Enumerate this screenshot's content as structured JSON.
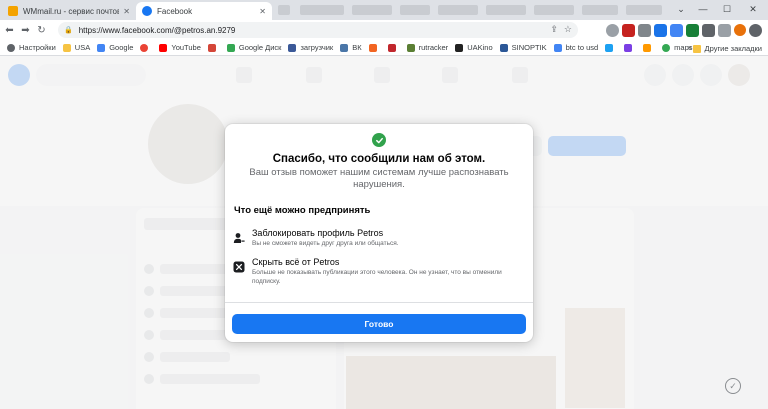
{
  "browser": {
    "tabs": [
      {
        "title": "WMmail.ru - сервис почтовых ра",
        "icon": "wmmail-favicon",
        "active": false
      },
      {
        "title": "Facebook",
        "icon": "facebook-favicon",
        "active": true
      }
    ],
    "url": "https://www.facebook.com/@petros.an.9279",
    "bookmarks": [
      {
        "label": "Настройки",
        "color": "#5f6368"
      },
      {
        "label": "USA",
        "color": "#f6c343"
      },
      {
        "label": "Google",
        "color": "#4285f4"
      },
      {
        "label": "",
        "color": "#ea4335"
      },
      {
        "label": "YouTube",
        "color": "#ff0000"
      },
      {
        "label": "",
        "color": "#d44638"
      },
      {
        "label": "Google Диск",
        "color": "#34a853"
      },
      {
        "label": "загрузчик",
        "color": "#3b5998"
      },
      {
        "label": "ВК",
        "color": "#4a76a8"
      },
      {
        "label": "",
        "color": "#f26522"
      },
      {
        "label": "",
        "color": "#c1272d"
      },
      {
        "label": "rutracker",
        "color": "#5b7f34"
      },
      {
        "label": "UAKino",
        "color": "#222222"
      },
      {
        "label": "SINOPTIK",
        "color": "#2b5797"
      },
      {
        "label": "btc to usd",
        "color": "#4285f4"
      },
      {
        "label": "",
        "color": "#1da1f2"
      },
      {
        "label": "",
        "color": "#7b3fe4"
      },
      {
        "label": "",
        "color": "#ff9900"
      },
      {
        "label": "maps",
        "color": "#34a853"
      }
    ],
    "more_bookmarks": "»",
    "other_bookmarks": "Другие закладки",
    "colors": {
      "tabstrip": "#dee1e6",
      "accent": "#1877f2"
    }
  },
  "dialog": {
    "title": "Спасибо, что сообщили нам об этом.",
    "subtitle": "Ваш отзыв поможет нашим системам лучше распознавать нарушения.",
    "section_title": "Что ещё можно предпринять",
    "options": [
      {
        "icon": "block-user-icon",
        "title": "Заблокировать профиль Petros",
        "description": "Вы не сможете видеть друг друга или общаться."
      },
      {
        "icon": "hide-all-icon",
        "title": "Скрыть всё от Petros",
        "description": "Больше не показывать публикации этого человека. Он не узнает, что вы отменили подписку."
      }
    ],
    "done_label": "Готово",
    "colors": {
      "check": "#31a24c",
      "button": "#1877f2"
    }
  }
}
